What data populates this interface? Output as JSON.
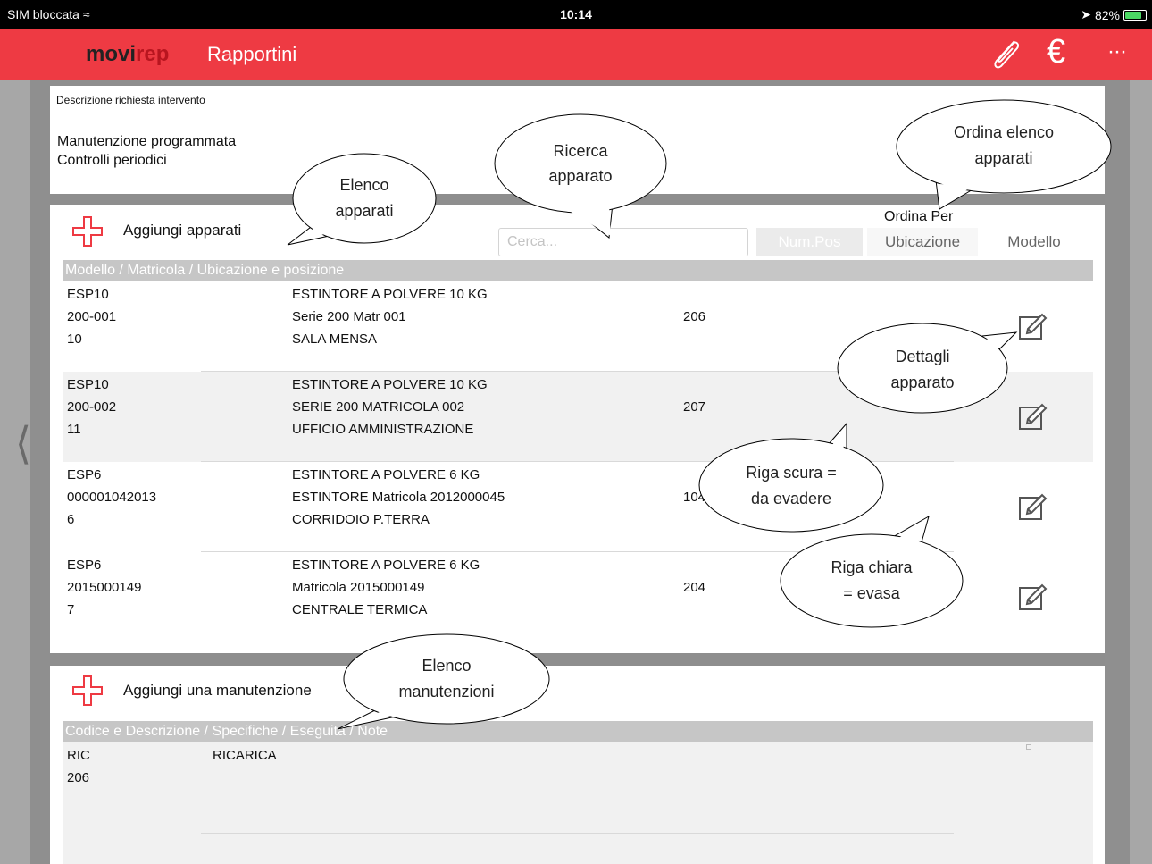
{
  "status": {
    "carrier": "SIM bloccata",
    "time": "10:14",
    "battery": "82%",
    "battery_level": 0.82
  },
  "nav": {
    "brand_a": "movi",
    "brand_b": "rep",
    "title": "Rapportini",
    "euro": "€",
    "more": "···"
  },
  "desc": {
    "label": "Descrizione richiesta intervento",
    "line1": "Manutenzione programmata",
    "line2": "Controlli periodici"
  },
  "apparati": {
    "add_label": "Aggiungi apparati",
    "search_placeholder": "Cerca...",
    "sort_title": "Ordina Per",
    "sort_numpos": "Num.Pos",
    "sort_ubicazione": "Ubicazione",
    "sort_modello": "Modello",
    "header": "Modello / Matricola / Ubicazione e posizione",
    "rows": [
      {
        "code": "ESP10",
        "serial": "200-001",
        "num": "10",
        "desc": "ESTINTORE A POLVERE 10 KG",
        "spec": "Serie 200 Matr 001",
        "loc": "SALA MENSA",
        "pos": "206"
      },
      {
        "code": "ESP10",
        "serial": "200-002",
        "num": "11",
        "desc": "ESTINTORE A POLVERE 10 KG",
        "spec": "SERIE 200 MATRICOLA 002",
        "loc": "UFFICIO AMMINISTRAZIONE",
        "pos": "207"
      },
      {
        "code": "ESP6",
        "serial": "000001042013",
        "num": "6",
        "desc": "ESTINTORE A POLVERE 6 KG",
        "spec": "ESTINTORE Matricola 2012000045",
        "loc": "CORRIDOIO P.TERRA",
        "pos": "104"
      },
      {
        "code": "ESP6",
        "serial": "2015000149",
        "num": "7",
        "desc": "ESTINTORE A POLVERE 6 KG",
        "spec": "Matricola 2015000149",
        "loc": "CENTRALE TERMICA",
        "pos": "204"
      }
    ]
  },
  "manutenzioni": {
    "add_label": "Aggiungi una manutenzione",
    "header": "Codice e Descrizione / Specifiche / Eseguita / Note",
    "row": {
      "code": "RIC",
      "desc": "RICARICA",
      "value": "206"
    }
  },
  "callouts": {
    "ricerca_1": "Ricerca",
    "ricerca_2": "apparato",
    "ordina_1": "Ordina elenco",
    "ordina_2": "apparati",
    "elenco_app_1": "Elenco",
    "elenco_app_2": "apparati",
    "dettagli_1": "Dettagli",
    "dettagli_2": "apparato",
    "scura_1": "Riga scura =",
    "scura_2": "da evadere",
    "chiara_1": "Riga chiara",
    "chiara_2": "= evasa",
    "elenco_man_1": "Elenco",
    "elenco_man_2": "manutenzioni"
  },
  "colors": {
    "accent": "#ee3a43",
    "brand_dark": "#222222",
    "row_dark": "#f1f1f1",
    "header_gray": "#c6c6c6"
  }
}
